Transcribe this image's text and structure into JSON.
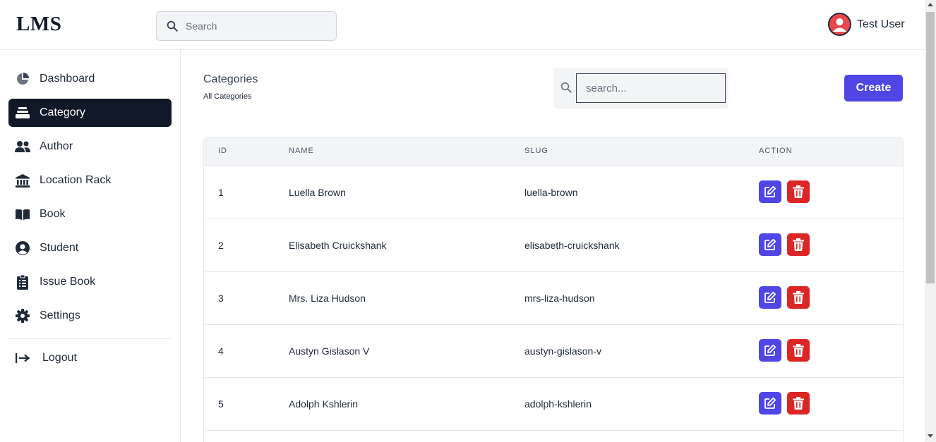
{
  "header": {
    "logo": "LMS",
    "search_placeholder": "Search",
    "user_name": "Test User"
  },
  "sidebar": {
    "items": [
      {
        "label": "Dashboard",
        "icon": "pie-chart-icon"
      },
      {
        "label": "Category",
        "icon": "stack-icon"
      },
      {
        "label": "Author",
        "icon": "users-icon"
      },
      {
        "label": "Location Rack",
        "icon": "building-icon"
      },
      {
        "label": "Book",
        "icon": "book-open-icon"
      },
      {
        "label": "Student",
        "icon": "user-circle-icon"
      },
      {
        "label": "Issue Book",
        "icon": "clipboard-icon"
      },
      {
        "label": "Settings",
        "icon": "gear-icon"
      }
    ],
    "active": "Category",
    "logout": "Logout"
  },
  "main": {
    "title": "Categories",
    "subtitle": "All Categories",
    "search_placeholder": "search...",
    "create_label": "Create"
  },
  "table": {
    "columns": [
      "ID",
      "NAME",
      "SLUG",
      "ACTION"
    ],
    "rows": [
      {
        "id": "1",
        "name": "Luella Brown",
        "slug": "luella-brown"
      },
      {
        "id": "2",
        "name": "Elisabeth Cruickshank",
        "slug": "elisabeth-cruickshank"
      },
      {
        "id": "3",
        "name": "Mrs. Liza Hudson",
        "slug": "mrs-liza-hudson"
      },
      {
        "id": "4",
        "name": "Austyn Gislason V",
        "slug": "austyn-gislason-v"
      },
      {
        "id": "5",
        "name": "Adolph Kshlerin",
        "slug": "adolph-kshlerin"
      }
    ]
  },
  "colors": {
    "primary": "#4f46e5",
    "danger": "#dc2626",
    "active_nav": "#111827"
  }
}
